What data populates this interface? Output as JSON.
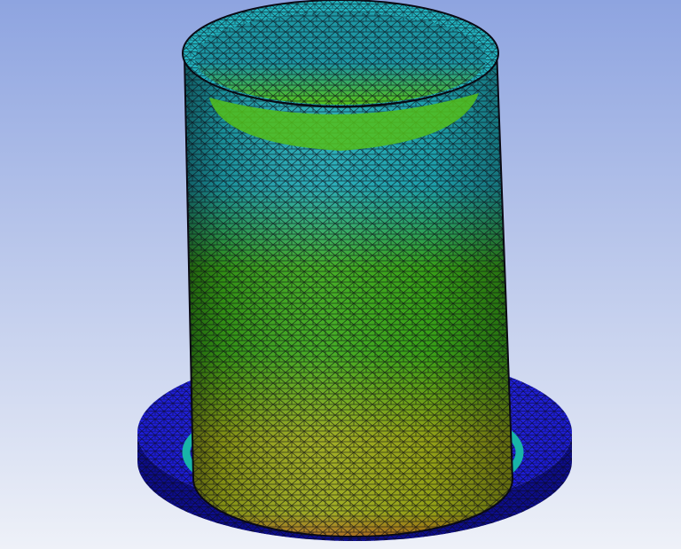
{
  "viewport": {
    "background_top": "#8ea4e0",
    "background_bottom": "#eef1f8"
  },
  "model": {
    "colors": {
      "flange": "#1a1ad0",
      "flange_edge": "#0d0d8a",
      "fillet_ring": "#18b4a8",
      "tube_top": "#1fa8b4",
      "tube_green": "#3aa818",
      "tube_yellow": "#9aa818",
      "tube_base": "#a86a18",
      "inner_top": "#1d97a4",
      "inner_bottom": "#54c01a",
      "rim": "#22b0bc",
      "mesh_line": "#0a0a14"
    }
  }
}
